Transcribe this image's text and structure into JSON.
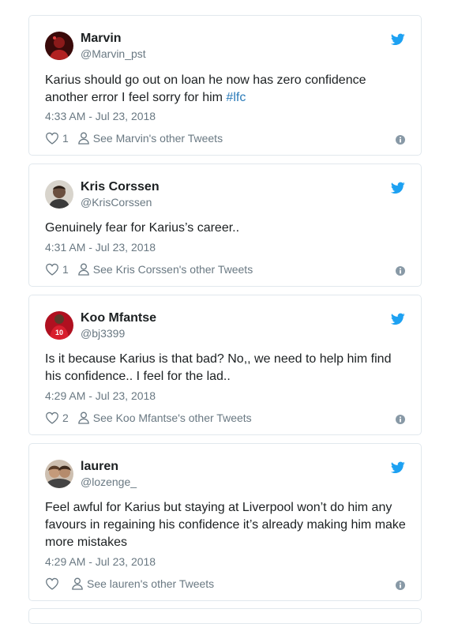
{
  "tweets": [
    {
      "name": "Marvin",
      "handle": "@Marvin_pst",
      "text_before": "Karius should go out on loan he now has zero confidence another error I feel sorry for him ",
      "hashtag": "#lfc",
      "time": "4:33 AM - Jul 23, 2018",
      "likes": "1",
      "other_tweets": "See Marvin's other Tweets",
      "avatar_color": "#8b1a1a"
    },
    {
      "name": "Kris Corssen",
      "handle": "@KrisCorssen",
      "text_before": "Genuinely fear for Karius’s career..",
      "hashtag": "",
      "time": "4:31 AM - Jul 23, 2018",
      "likes": "1",
      "other_tweets": "See Kris Corssen's other Tweets",
      "avatar_color": "#5a4636"
    },
    {
      "name": "Koo Mfantse",
      "handle": "@bj3399",
      "text_before": "Is it because Karius is that bad? No,, we need to help him find his confidence.. I feel for the lad..",
      "hashtag": "",
      "time": "4:29 AM - Jul 23, 2018",
      "likes": "2",
      "other_tweets": "See Koo Mfantse's other Tweets",
      "avatar_color": "#c8102e"
    },
    {
      "name": "lauren",
      "handle": "@lozenge_",
      "text_before": "Feel awful for Karius but staying at Liverpool won’t do him any favours in regaining his confidence it’s already making him make more mistakes",
      "hashtag": "",
      "time": "4:29 AM - Jul 23, 2018",
      "likes": "",
      "other_tweets": "See lauren's other Tweets",
      "avatar_color": "#a07a5e"
    }
  ],
  "colors": {
    "twitter_blue": "#1da1f2",
    "link": "#2b7bb9",
    "muted": "#697882",
    "border": "#e1e8ed"
  },
  "icons": [
    "twitter-bird-icon",
    "heart-icon",
    "person-icon",
    "info-icon"
  ]
}
